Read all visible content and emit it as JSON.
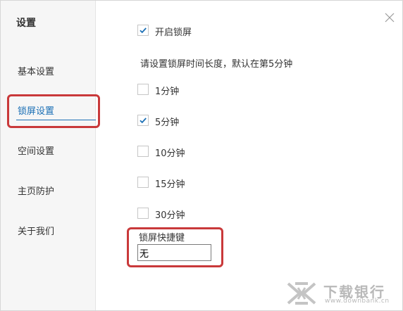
{
  "sidebar": {
    "title": "设置",
    "items": [
      {
        "label": "基本设置"
      },
      {
        "label": "锁屏设置"
      },
      {
        "label": "空间设置"
      },
      {
        "label": "主页防护"
      },
      {
        "label": "关于我们"
      }
    ],
    "active_index": 1
  },
  "main": {
    "enable_lock": {
      "label": "开启锁屏",
      "checked": true
    },
    "description": "请设置锁屏时间长度，默认在第5分钟",
    "options": [
      {
        "label": "1分钟",
        "checked": false
      },
      {
        "label": "5分钟",
        "checked": true
      },
      {
        "label": "10分钟",
        "checked": false
      },
      {
        "label": "15分钟",
        "checked": false
      },
      {
        "label": "30分钟",
        "checked": false
      }
    ],
    "hotkey": {
      "label": "锁屏快捷键",
      "value": "无"
    }
  },
  "watermark": {
    "text": "下载银行",
    "url": "www.downbank.cn"
  },
  "colors": {
    "accent": "#1a6fb5",
    "highlight": "#c9393a",
    "sidebar_bg": "#f6f6f6"
  }
}
